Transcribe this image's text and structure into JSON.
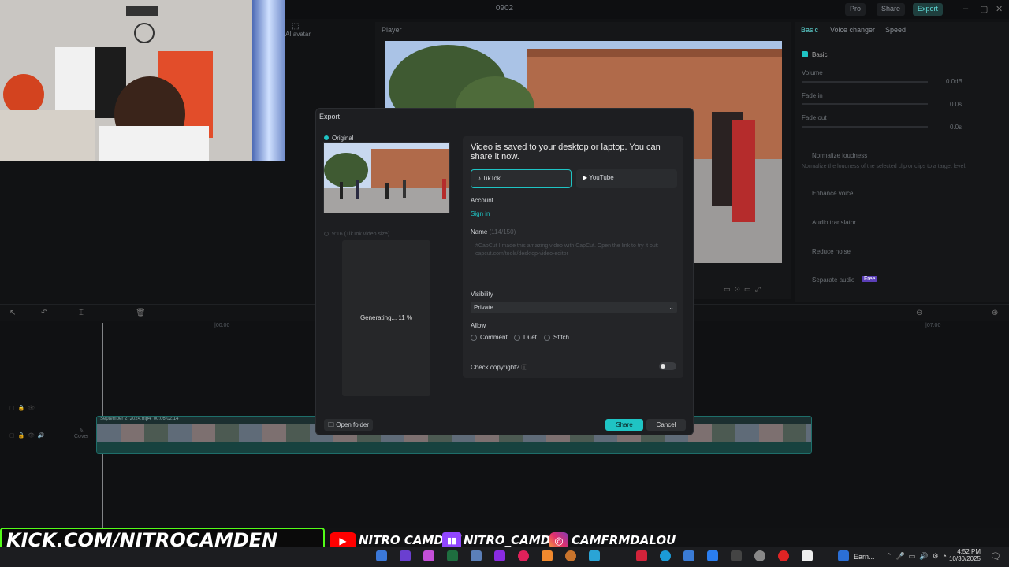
{
  "app": {
    "project_title": "0902",
    "pro_label": "Pro",
    "share_label": "Share",
    "export_label": "Export"
  },
  "sidebar": {
    "ai_avatar_label": "AI avatar"
  },
  "player": {
    "label": "Player"
  },
  "right_panel": {
    "tabs": [
      "Basic",
      "Voice changer",
      "Speed"
    ],
    "basic_label": "Basic",
    "volume_label": "Volume",
    "volume_value": "0.0dB",
    "fade_in_label": "Fade in",
    "fade_in_value": "0.0s",
    "fade_out_label": "Fade out",
    "fade_out_value": "0.0s",
    "normalize_label": "Normalize loudness",
    "normalize_desc": "Normalize the loudness of the selected clip or clips to a target level.",
    "enhance_label": "Enhance voice",
    "translator_label": "Audio translator",
    "reduce_noise_label": "Reduce noise",
    "separate_audio_label": "Separate audio",
    "free_badge": "Free"
  },
  "timeline": {
    "clip_name": "September 2, 2024.mp4",
    "clip_duration": "00:06:02:14",
    "cover_label": "Cover",
    "tick1": "|00:00",
    "tick2": "|07:00"
  },
  "dialog": {
    "title": "Export",
    "original_label": "Original",
    "size_label": "9:16 (TikTok video size)",
    "generating_label": "Generating... 11 %",
    "saved_message": "Video is saved to your desktop or laptop. You can share it now.",
    "tiktok_label": "TikTok",
    "youtube_label": "YouTube",
    "account_label": "Account",
    "sign_in_label": "Sign in",
    "name_label": "Name",
    "name_count": "(114/150)",
    "name_placeholder": "#CapCut I made this amazing video with CapCut. Open the link to try it out: capcut.com/tools/desktop-video-editor",
    "visibility_label": "Visibility",
    "visibility_value": "Private",
    "allow_label": "Allow",
    "allow_options": [
      "Comment",
      "Duet",
      "Stitch"
    ],
    "copyright_label": "Check copyright?",
    "open_folder_label": "Open folder",
    "share_button": "Share",
    "cancel_button": "Cancel"
  },
  "banner": {
    "kick_url": "KICK.COM/NITROCAMDEN",
    "youtube_handle": "NITRO CAMDEN",
    "twitch_handle": "NITRO_CAMDEN",
    "instagram_handle": "CAMFRMDALOU"
  },
  "taskbar": {
    "running_app": "Earn...",
    "time": "4:52 PM",
    "date": "10/30/2025"
  },
  "colors": {
    "accent": "#1fc4c4",
    "kick_green": "#53fc18",
    "youtube_red": "#ff0000",
    "twitch_purple": "#9146ff"
  }
}
